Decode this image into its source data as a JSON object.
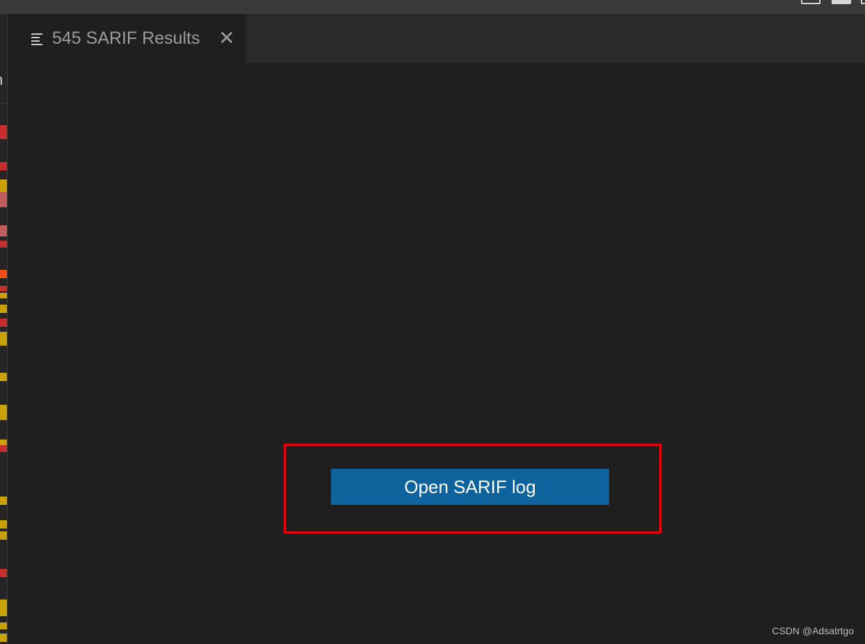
{
  "tab": {
    "label": "545 SARIF Results",
    "icon": "list-icon",
    "close_icon": "close-icon",
    "close_glyph": "✕"
  },
  "gutter": {
    "partial_text": "n"
  },
  "main": {
    "open_button_label": "Open SARIF log"
  },
  "watermark": "CSDN @Adsatrtgo",
  "colors": {
    "background": "#1f1f1f",
    "button": "#0e639c",
    "highlight": "#e8000b",
    "error_marker": "#c72e2e",
    "warning_marker": "#c9a10b"
  }
}
